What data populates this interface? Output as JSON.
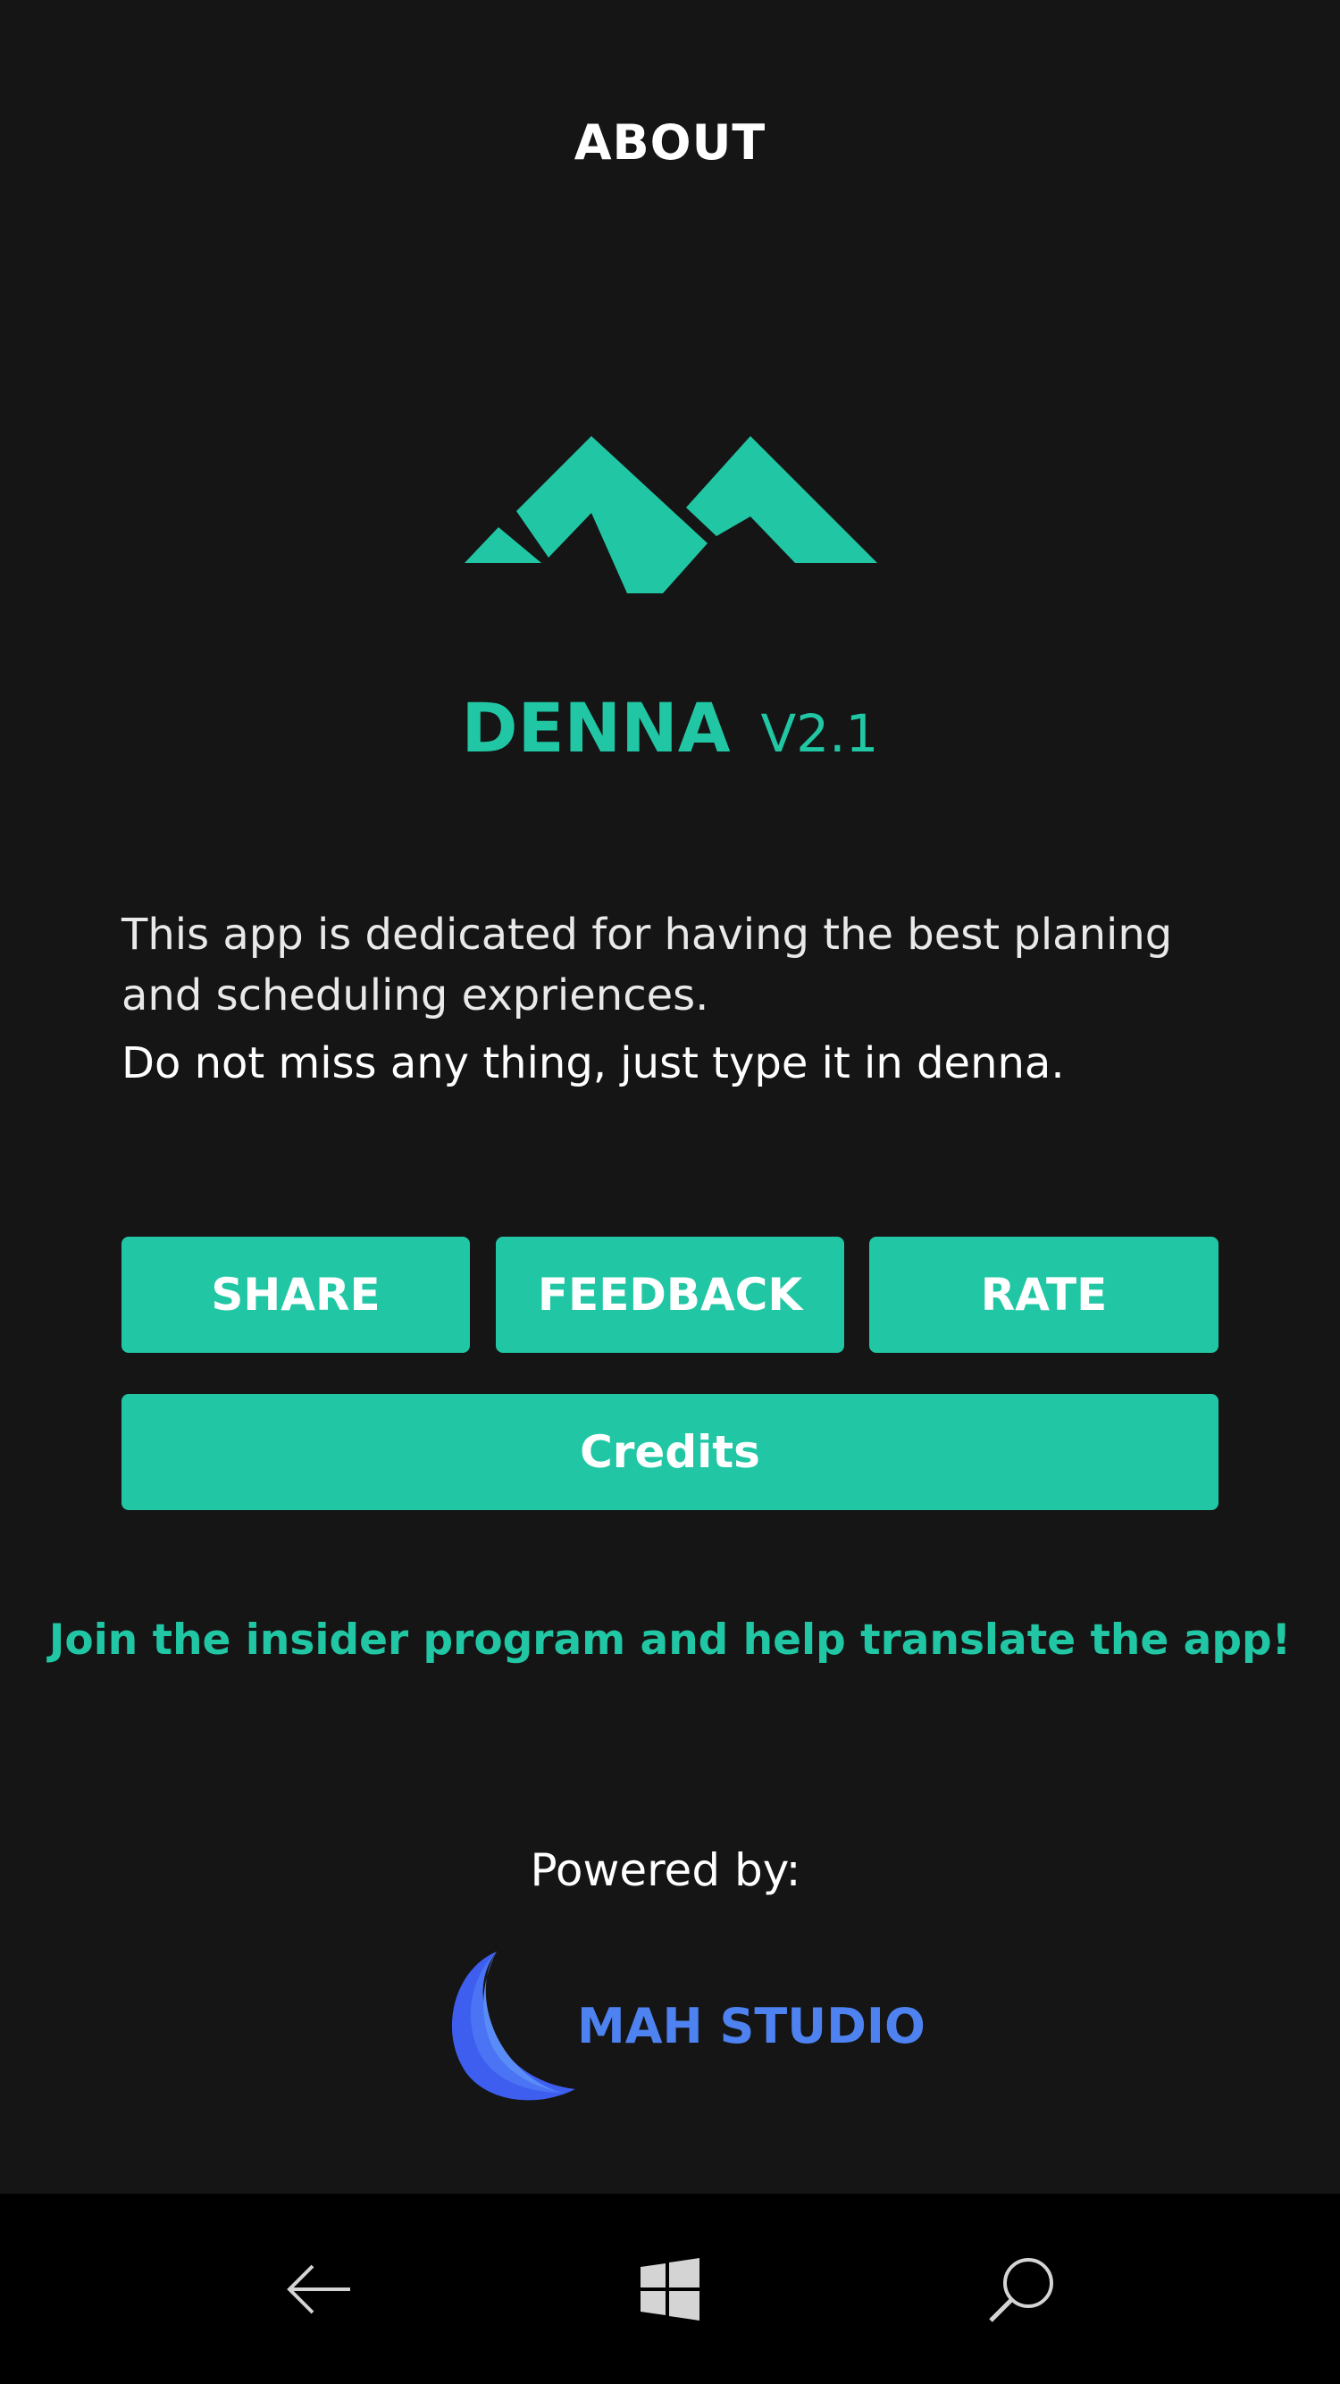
{
  "header": {
    "title": "ABOUT"
  },
  "app": {
    "name": "DENNA",
    "version": "V2.1",
    "logo_icon": "mountains-logo-icon",
    "accent_color": "#21c7a4"
  },
  "description": {
    "line1": "This app is dedicated for having the best planing and scheduling expriences.",
    "line2": "Do not miss any thing, just type it in denna."
  },
  "actions": {
    "share_label": "SHARE",
    "feedback_label": "FEEDBACK",
    "rate_label": "RATE",
    "credits_label": "Credits"
  },
  "insider": {
    "link_text": "Join the insider program and help translate the app!"
  },
  "footer": {
    "powered_by": "Powered by:",
    "studio_name": "MAH STUDIO",
    "studio_logo_icon": "crescent-moon-icon",
    "studio_color": "#4d82f0"
  },
  "navigation": {
    "back_icon": "back-arrow-icon",
    "home_icon": "windows-logo-icon",
    "search_icon": "search-icon"
  },
  "colors": {
    "background": "#151515",
    "nav_background": "#000000",
    "text": "#ffffff"
  }
}
